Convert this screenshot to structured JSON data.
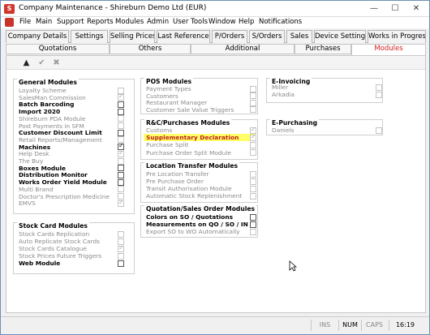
{
  "window": {
    "title": "Company Maintenance - Shireburn Demo Ltd (EUR)",
    "minimize_icon": "—",
    "maximize_icon": "☐",
    "close_icon": "✕"
  },
  "menu": [
    "File",
    "Main",
    "Support",
    "Reports",
    "Modules",
    "Admin",
    "User Tools",
    "Window",
    "Help",
    "Notifications"
  ],
  "tabs_row1": [
    "Company Details",
    "Settings",
    "Selling Prices",
    "Last Reference",
    "P/Orders",
    "S/Orders",
    "Sales",
    "Device Settings",
    "Works in Progress"
  ],
  "tabs_row2": [
    "Quotations",
    "Others",
    "Additional",
    "Purchases",
    "Modules"
  ],
  "active_tab": "Modules",
  "toolbar": {
    "up": "▲",
    "check": "✔",
    "cancel": "✖"
  },
  "groups": {
    "general": {
      "title": "General Modules",
      "items": [
        {
          "label": "Loyalty Scheme",
          "enabled": false,
          "checked": false
        },
        {
          "label": "SalesMan Commission",
          "enabled": false,
          "checked": true
        },
        {
          "label": "Batch Barcoding",
          "enabled": true,
          "checked": false
        },
        {
          "label": "Import 2020",
          "enabled": true,
          "checked": false
        },
        {
          "label": "Shireburn PDA Module",
          "enabled": false,
          "checked": false
        },
        {
          "label": "Post Payments in SFM",
          "enabled": false,
          "checked": false
        },
        {
          "label": "Customer Discount Limit",
          "enabled": true,
          "checked": false
        },
        {
          "label": "Retail Reports/Management",
          "enabled": false,
          "checked": false
        },
        {
          "label": "Machines",
          "enabled": true,
          "checked": true
        },
        {
          "label": "Help Desk",
          "enabled": false,
          "checked": true
        },
        {
          "label": "The Buy",
          "enabled": false,
          "checked": false
        },
        {
          "label": "Boxes Module",
          "enabled": true,
          "checked": false
        },
        {
          "label": "Distribution Monitor",
          "enabled": true,
          "checked": false
        },
        {
          "label": "Works Order Yield Module",
          "enabled": true,
          "checked": false
        },
        {
          "label": "Multi Brand",
          "enabled": false,
          "checked": false
        },
        {
          "label": "Doctor's Prescription Medicine",
          "enabled": false,
          "checked": false
        },
        {
          "label": "EMVS",
          "enabled": false,
          "checked": true
        }
      ]
    },
    "stock": {
      "title": "Stock Card Modules",
      "items": [
        {
          "label": "Stock Cards Replication",
          "enabled": false,
          "checked": false
        },
        {
          "label": "Auto Replicate Stock Cards",
          "enabled": false,
          "checked": false
        },
        {
          "label": "Stock Cards Catalogue",
          "enabled": false,
          "checked": true
        },
        {
          "label": "Stock Prices Future Triggers",
          "enabled": false,
          "checked": false
        },
        {
          "label": "Web Module",
          "enabled": true,
          "checked": false
        }
      ]
    },
    "pos": {
      "title": "POS Modules",
      "items": [
        {
          "label": "Payment Types",
          "enabled": false,
          "checked": false
        },
        {
          "label": "Customers",
          "enabled": false,
          "checked": false
        },
        {
          "label": "Restaurant Manager",
          "enabled": false,
          "checked": false
        },
        {
          "label": "Customer Sale Value Triggers",
          "enabled": false,
          "checked": false
        }
      ]
    },
    "rc": {
      "title": "R&C/Purchases Modules",
      "items": [
        {
          "label": "Customs",
          "enabled": false,
          "checked": true
        },
        {
          "label": "Supplementary Declaration",
          "enabled": false,
          "checked": true,
          "highlight": true
        },
        {
          "label": "Purchase Split",
          "enabled": false,
          "checked": false
        },
        {
          "label": "Purchase Order Split Module",
          "enabled": false,
          "checked": false
        }
      ]
    },
    "location": {
      "title": "Location Transfer Modules",
      "items": [
        {
          "label": "Pre Location Transfer",
          "enabled": false,
          "checked": false
        },
        {
          "label": "Pre Purchase Order",
          "enabled": false,
          "checked": false
        },
        {
          "label": "Transit Authorisation Module",
          "enabled": false,
          "checked": false
        },
        {
          "label": "Automatic Stock Replenishment",
          "enabled": false,
          "checked": false
        }
      ]
    },
    "quotation": {
      "title": "Quotation/Sales Order Modules",
      "items": [
        {
          "label": "Colors on SO / Quotations",
          "enabled": true,
          "checked": false
        },
        {
          "label": "Measurements on QO / SO / IN",
          "enabled": true,
          "checked": false
        },
        {
          "label": "Export SO to WO Automatically",
          "enabled": false,
          "checked": false
        }
      ]
    },
    "einvoicing": {
      "title": "E-Invoicing",
      "items": [
        {
          "label": "Miller",
          "enabled": false,
          "checked": false
        },
        {
          "label": "Arkadia",
          "enabled": false,
          "checked": false
        }
      ]
    },
    "epurchasing": {
      "title": "E-Purchasing",
      "items": [
        {
          "label": "Daniels",
          "enabled": false,
          "checked": false
        }
      ]
    }
  },
  "status": {
    "ins": "INS",
    "num": "NUM",
    "caps": "CAPS",
    "time": "16:19"
  }
}
